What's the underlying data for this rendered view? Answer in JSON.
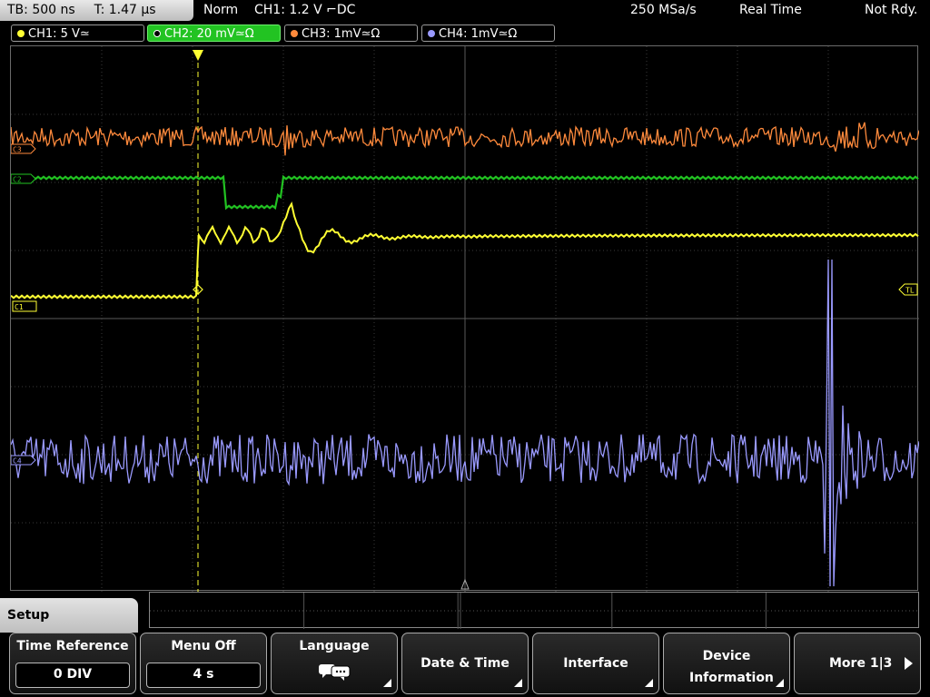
{
  "topbar": {
    "timebase": "TB: 500 ns",
    "trigger_pos": "T: 1.47 µs",
    "mode": "Norm",
    "trigger_info": "CH1: 1.2 V ⌐DC",
    "sample_rate": "250 MSa/s",
    "acq_mode": "Real Time",
    "status": "Not Rdy."
  },
  "channels": [
    {
      "label": "CH1: 5 V≃",
      "color": "#ffff33"
    },
    {
      "label": "CH2: 20 mV≃Ω",
      "color": "#22c322"
    },
    {
      "label": "CH3: 1mV≃Ω",
      "color": "#ff8a3c"
    },
    {
      "label": "CH4: 1mV≃Ω",
      "color": "#9a9aff"
    }
  ],
  "markers": {
    "c3": "C3",
    "c2": "C2",
    "c1": "C1",
    "c4": "C4",
    "trigger_level": "TL"
  },
  "menu": {
    "title": "Setup",
    "softkeys": [
      {
        "label": "Time Reference",
        "value": "0 DIV"
      },
      {
        "label": "Menu Off",
        "value": "4 s"
      },
      {
        "label": "Language",
        "icon": "speech-bubbles-icon"
      },
      {
        "label": "Date & Time"
      },
      {
        "label": "Interface"
      },
      {
        "label": "Device Information"
      },
      {
        "label": "More 1|3"
      }
    ]
  }
}
